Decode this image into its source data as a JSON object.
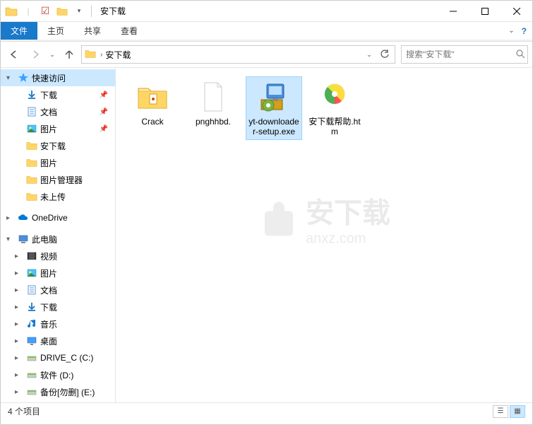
{
  "window": {
    "title": "安下载",
    "qat_dropdown": "▾"
  },
  "tabs": {
    "file": "文件",
    "home": "主页",
    "share": "共享",
    "view": "查看"
  },
  "nav": {
    "address": "安下载",
    "search_placeholder": "搜索\"安下载\""
  },
  "sidebar": {
    "quick_access": "快速访问",
    "items_quick": [
      {
        "label": "下载",
        "icon": "download",
        "pinned": true
      },
      {
        "label": "文档",
        "icon": "document",
        "pinned": true
      },
      {
        "label": "图片",
        "icon": "pictures",
        "pinned": true
      },
      {
        "label": "安下载",
        "icon": "folder",
        "pinned": false
      },
      {
        "label": "图片",
        "icon": "folder",
        "pinned": false
      },
      {
        "label": "图片管理器",
        "icon": "folder",
        "pinned": false
      },
      {
        "label": "未上传",
        "icon": "folder",
        "pinned": false
      }
    ],
    "onedrive": "OneDrive",
    "this_pc": "此电脑",
    "items_pc": [
      {
        "label": "视频",
        "icon": "videos"
      },
      {
        "label": "图片",
        "icon": "pictures"
      },
      {
        "label": "文档",
        "icon": "document"
      },
      {
        "label": "下载",
        "icon": "download"
      },
      {
        "label": "音乐",
        "icon": "music"
      },
      {
        "label": "桌面",
        "icon": "desktop"
      },
      {
        "label": "DRIVE_C (C:)",
        "icon": "drive"
      },
      {
        "label": "软件 (D:)",
        "icon": "drive"
      },
      {
        "label": "备份[勿删] (E:)",
        "icon": "drive"
      }
    ]
  },
  "files": [
    {
      "label": "Crack",
      "type": "folder"
    },
    {
      "label": "pnghhbd.",
      "type": "file-blank"
    },
    {
      "label": "yt-downloader-setup.exe",
      "type": "installer",
      "selected": true
    },
    {
      "label": "安下载帮助.htm",
      "type": "htm"
    }
  ],
  "status": {
    "count": "4 个项目"
  },
  "watermark": {
    "main": "安下载",
    "sub": "anxz.com"
  }
}
